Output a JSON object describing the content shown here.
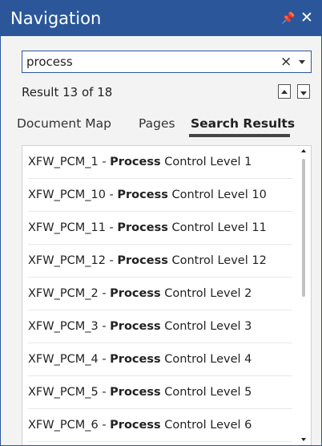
{
  "panel": {
    "title": "Navigation",
    "pin_icon": "pin-icon",
    "close_icon": "close-icon"
  },
  "search": {
    "value": "process",
    "clear_label": "×",
    "result_text": "Result 13 of 18"
  },
  "tabs": [
    {
      "label": "Document Map",
      "selected": false
    },
    {
      "label": "Pages",
      "selected": false
    },
    {
      "label": "Search Results",
      "selected": true
    }
  ],
  "results": [
    {
      "prefix": "XFW_PCM_1 - ",
      "match": "Process",
      "suffix": " Control Level 1"
    },
    {
      "prefix": "XFW_PCM_10 - ",
      "match": "Process",
      "suffix": " Control Level 10"
    },
    {
      "prefix": "XFW_PCM_11 - ",
      "match": "Process",
      "suffix": " Control Level 11"
    },
    {
      "prefix": "XFW_PCM_12 - ",
      "match": "Process",
      "suffix": " Control Level 12"
    },
    {
      "prefix": "XFW_PCM_2 - ",
      "match": "Process",
      "suffix": " Control Level 2"
    },
    {
      "prefix": "XFW_PCM_3 - ",
      "match": "Process",
      "suffix": " Control Level 3"
    },
    {
      "prefix": "XFW_PCM_4 - ",
      "match": "Process",
      "suffix": " Control Level 4"
    },
    {
      "prefix": "XFW_PCM_5 - ",
      "match": "Process",
      "suffix": " Control Level 5"
    },
    {
      "prefix": "XFW_PCM_6 - ",
      "match": "Process",
      "suffix": " Control Level 6"
    }
  ],
  "colors": {
    "accent": "#2b579a",
    "background": "#f3f3f3",
    "list_background": "#ffffff"
  }
}
